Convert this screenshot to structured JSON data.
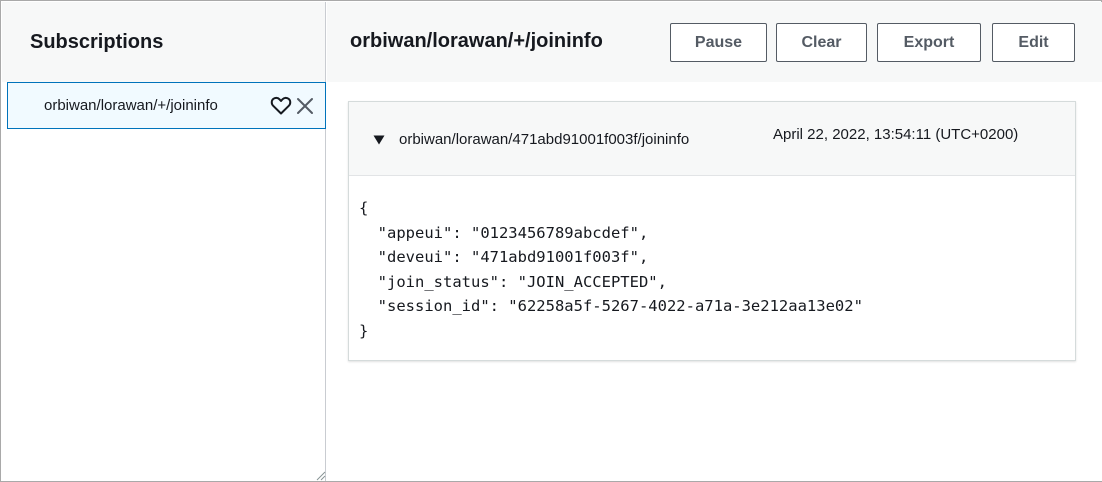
{
  "subscriptions": {
    "title": "Subscriptions",
    "items": [
      {
        "label": "orbiwan/lorawan/+/joininfo",
        "icons": [
          "heart-icon",
          "close-icon"
        ]
      }
    ]
  },
  "main": {
    "topic_title": "orbiwan/lorawan/+/joininfo",
    "buttons": {
      "pause": "Pause",
      "clear": "Clear",
      "export": "Export",
      "edit": "Edit"
    },
    "messages": [
      {
        "topic": "orbiwan/lorawan/471abd91001f003f/joininfo",
        "timestamp": "April 22, 2022, 13:54:11 (UTC+0200)",
        "payload_lines": [
          "{",
          "  \"appeui\": \"0123456789abcdef\",",
          "  \"deveui\": \"471abd91001f003f\",",
          "  \"join_status\": \"JOIN_ACCEPTED\",",
          "  \"session_id\": \"62258a5f-5267-4022-a71a-3e212aa13e02\"",
          "}"
        ]
      }
    ]
  },
  "colors": {
    "accent": "#0073bb",
    "header_bg": "#f7f8f8",
    "button_text": "#545b64",
    "text": "#16191f"
  }
}
